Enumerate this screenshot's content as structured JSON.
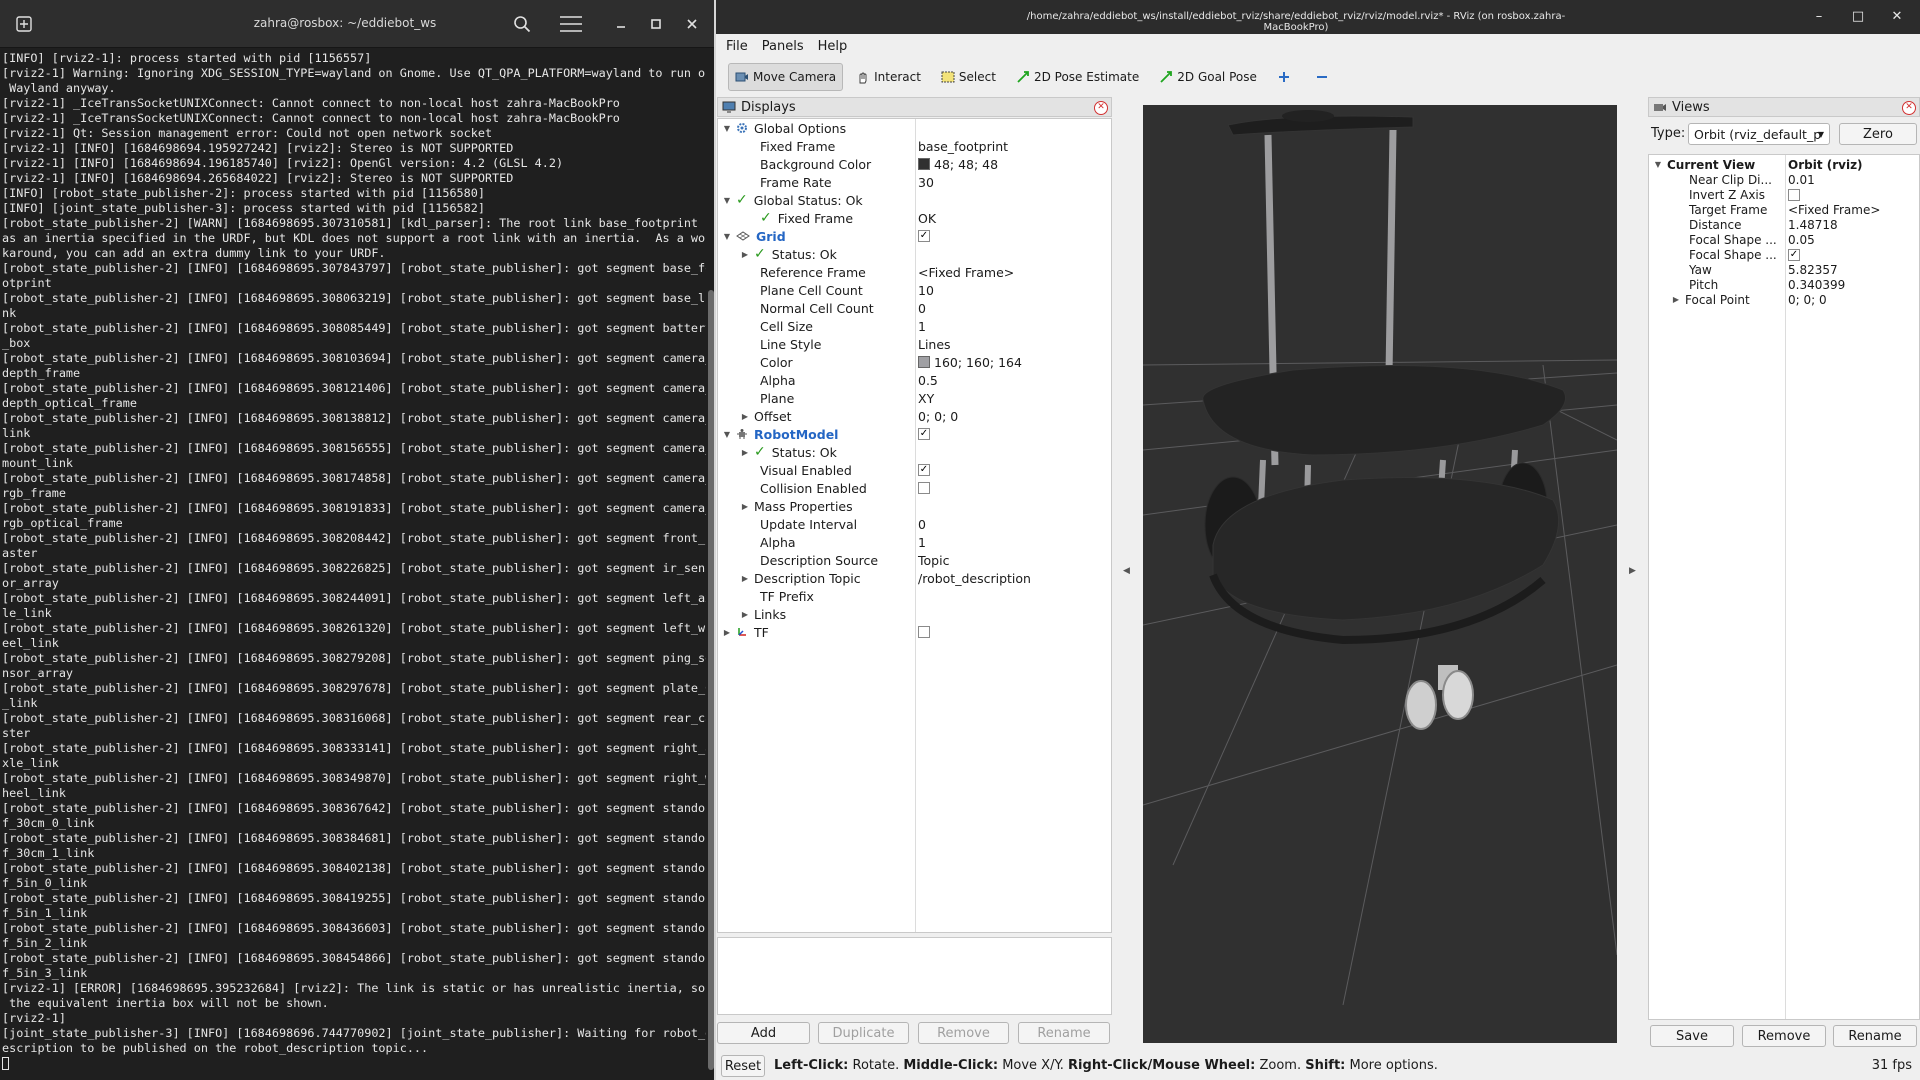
{
  "terminal": {
    "title": "zahra@rosbox: ~/eddiebot_ws",
    "lines": [
      "[INFO] [rviz2-1]: process started with pid [1156557]",
      "[rviz2-1] Warning: Ignoring XDG_SESSION_TYPE=wayland on Gnome. Use QT_QPA_PLATFORM=wayland to run on",
      " Wayland anyway.",
      "[rviz2-1] _IceTransSocketUNIXConnect: Cannot connect to non-local host zahra-MacBookPro",
      "[rviz2-1] _IceTransSocketUNIXConnect: Cannot connect to non-local host zahra-MacBookPro",
      "[rviz2-1] Qt: Session management error: Could not open network socket",
      "[rviz2-1] [INFO] [1684698694.195927242] [rviz2]: Stereo is NOT SUPPORTED",
      "[rviz2-1] [INFO] [1684698694.196185740] [rviz2]: OpenGl version: 4.2 (GLSL 4.2)",
      "[rviz2-1] [INFO] [1684698694.265684022] [rviz2]: Stereo is NOT SUPPORTED",
      "[INFO] [robot_state_publisher-2]: process started with pid [1156580]",
      "[INFO] [joint_state_publisher-3]: process started with pid [1156582]",
      "[robot_state_publisher-2] [WARN] [1684698695.307310581] [kdl_parser]: The root link base_footprint h",
      "as an inertia specified in the URDF, but KDL does not support a root link with an inertia.  As a wor",
      "karound, you can add an extra dummy link to your URDF.",
      "[robot_state_publisher-2] [INFO] [1684698695.307843797] [robot_state_publisher]: got segment base_fo",
      "otprint",
      "[robot_state_publisher-2] [INFO] [1684698695.308063219] [robot_state_publisher]: got segment base_li",
      "nk",
      "[robot_state_publisher-2] [INFO] [1684698695.308085449] [robot_state_publisher]: got segment battery",
      "_box",
      "[robot_state_publisher-2] [INFO] [1684698695.308103694] [robot_state_publisher]: got segment camera_",
      "depth_frame",
      "[robot_state_publisher-2] [INFO] [1684698695.308121406] [robot_state_publisher]: got segment camera_",
      "depth_optical_frame",
      "[robot_state_publisher-2] [INFO] [1684698695.308138812] [robot_state_publisher]: got segment camera_",
      "link",
      "[robot_state_publisher-2] [INFO] [1684698695.308156555] [robot_state_publisher]: got segment camera_",
      "mount_link",
      "[robot_state_publisher-2] [INFO] [1684698695.308174858] [robot_state_publisher]: got segment camera_",
      "rgb_frame",
      "[robot_state_publisher-2] [INFO] [1684698695.308191833] [robot_state_publisher]: got segment camera_",
      "rgb_optical_frame",
      "[robot_state_publisher-2] [INFO] [1684698695.308208442] [robot_state_publisher]: got segment front_c",
      "aster",
      "[robot_state_publisher-2] [INFO] [1684698695.308226825] [robot_state_publisher]: got segment ir_sens",
      "or_array",
      "[robot_state_publisher-2] [INFO] [1684698695.308244091] [robot_state_publisher]: got segment left_ax",
      "le_link",
      "[robot_state_publisher-2] [INFO] [1684698695.308261320] [robot_state_publisher]: got segment left_wh",
      "eel_link",
      "[robot_state_publisher-2] [INFO] [1684698695.308279208] [robot_state_publisher]: got segment ping_se",
      "nsor_array",
      "[robot_state_publisher-2] [INFO] [1684698695.308297678] [robot_state_publisher]: got segment plate_0",
      "_link",
      "[robot_state_publisher-2] [INFO] [1684698695.308316068] [robot_state_publisher]: got segment rear_ca",
      "ster",
      "[robot_state_publisher-2] [INFO] [1684698695.308333141] [robot_state_publisher]: got segment right_a",
      "xle_link",
      "[robot_state_publisher-2] [INFO] [1684698695.308349870] [robot_state_publisher]: got segment right_w",
      "heel_link",
      "[robot_state_publisher-2] [INFO] [1684698695.308367642] [robot_state_publisher]: got segment standof",
      "f_30cm_0_link",
      "[robot_state_publisher-2] [INFO] [1684698695.308384681] [robot_state_publisher]: got segment standof",
      "f_30cm_1_link",
      "[robot_state_publisher-2] [INFO] [1684698695.308402138] [robot_state_publisher]: got segment standof",
      "f_5in_0_link",
      "[robot_state_publisher-2] [INFO] [1684698695.308419255] [robot_state_publisher]: got segment standof",
      "f_5in_1_link",
      "[robot_state_publisher-2] [INFO] [1684698695.308436603] [robot_state_publisher]: got segment standof",
      "f_5in_2_link",
      "[robot_state_publisher-2] [INFO] [1684698695.308454866] [robot_state_publisher]: got segment standof",
      "f_5in_3_link",
      "[rviz2-1] [ERROR] [1684698695.395232684] [rviz2]: The link is static or has unrealistic inertia, so",
      " the equivalent inertia box will not be shown.",
      "[rviz2-1]",
      "[joint_state_publisher-3] [INFO] [1684698696.744770902] [joint_state_publisher]: Waiting for robot_d",
      "escription to be published on the robot_description topic..."
    ]
  },
  "rviz": {
    "title": "/home/zahra/eddiebot_ws/install/eddiebot_rviz/share/eddiebot_rviz/rviz/model.rviz* - RViz (on rosbox.zahra-MacBookPro)",
    "menu": [
      "File",
      "Panels",
      "Help"
    ],
    "tools": {
      "move_camera": "Move Camera",
      "interact": "Interact",
      "select": "Select",
      "pose_estimate": "2D Pose Estimate",
      "goal_pose": "2D Goal Pose"
    },
    "displays": {
      "title": "Displays",
      "global_options": "Global Options",
      "fixed_frame": {
        "label": "Fixed Frame",
        "value": "base_footprint"
      },
      "background_color": {
        "label": "Background Color",
        "value": "48; 48; 48",
        "color": "#303030"
      },
      "frame_rate": {
        "label": "Frame Rate",
        "value": "30"
      },
      "global_status": "Global Status: Ok",
      "gs_fixed_frame": {
        "label": "Fixed Frame",
        "value": "OK"
      },
      "grid": "Grid",
      "grid_status": "Status: Ok",
      "reference_frame": {
        "label": "Reference Frame",
        "value": "<Fixed Frame>"
      },
      "plane_cell_count": {
        "label": "Plane Cell Count",
        "value": "10"
      },
      "normal_cell_count": {
        "label": "Normal Cell Count",
        "value": "0"
      },
      "cell_size": {
        "label": "Cell Size",
        "value": "1"
      },
      "line_style": {
        "label": "Line Style",
        "value": "Lines"
      },
      "grid_color": {
        "label": "Color",
        "value": "160; 160; 164",
        "color": "#a0a0a4"
      },
      "grid_alpha": {
        "label": "Alpha",
        "value": "0.5"
      },
      "plane": {
        "label": "Plane",
        "value": "XY"
      },
      "offset": {
        "label": "Offset",
        "value": "0; 0; 0"
      },
      "robot_model": "RobotModel",
      "rm_status": "Status: Ok",
      "visual_enabled": {
        "label": "Visual Enabled"
      },
      "collision_enabled": {
        "label": "Collision Enabled"
      },
      "mass_properties": {
        "label": "Mass Properties"
      },
      "update_interval": {
        "label": "Update Interval",
        "value": "0"
      },
      "rm_alpha": {
        "label": "Alpha",
        "value": "1"
      },
      "description_source": {
        "label": "Description Source",
        "value": "Topic"
      },
      "description_topic": {
        "label": "Description Topic",
        "value": "/robot_description"
      },
      "tf_prefix": {
        "label": "TF Prefix"
      },
      "links": {
        "label": "Links"
      },
      "tf": "TF",
      "buttons": {
        "add": "Add",
        "duplicate": "Duplicate",
        "remove": "Remove",
        "rename": "Rename"
      }
    },
    "views": {
      "title": "Views",
      "type_label": "Type:",
      "type_value": "Orbit (rviz_default_p",
      "zero": "Zero",
      "current_view": {
        "label": "Current View",
        "value": "Orbit (rviz)"
      },
      "near_clip": {
        "label": "Near Clip Di...",
        "value": "0.01"
      },
      "invert_z": {
        "label": "Invert Z Axis"
      },
      "target_frame": {
        "label": "Target Frame",
        "value": "<Fixed Frame>"
      },
      "distance": {
        "label": "Distance",
        "value": "1.48718"
      },
      "focal_shape_1": {
        "label": "Focal Shape ...",
        "value": "0.05"
      },
      "focal_shape_2": {
        "label": "Focal Shape ..."
      },
      "yaw": {
        "label": "Yaw",
        "value": "5.82357"
      },
      "pitch": {
        "label": "Pitch",
        "value": "0.340399"
      },
      "focal_point": {
        "label": "Focal Point",
        "value": "0; 0; 0"
      },
      "buttons": {
        "save": "Save",
        "remove": "Remove",
        "rename": "Rename"
      }
    },
    "status": {
      "reset": "Reset",
      "left_click": "Left-Click:",
      "left_click_desc": "Rotate.",
      "middle_click": "Middle-Click:",
      "middle_click_desc": "Move X/Y.",
      "right_click": "Right-Click/Mouse Wheel:",
      "right_click_desc": "Zoom.",
      "shift": "Shift:",
      "shift_desc": "More options.",
      "fps": "31 fps"
    }
  }
}
